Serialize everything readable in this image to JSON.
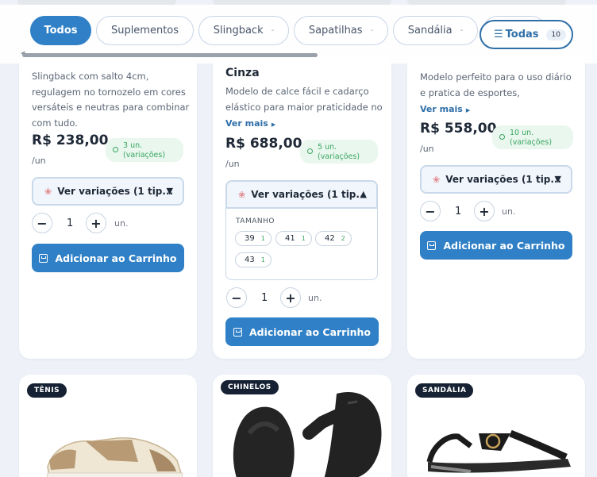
{
  "filters": {
    "chips": [
      {
        "label": "Todos",
        "active": true
      },
      {
        "label": "Suplementos",
        "active": false
      },
      {
        "label": "Slingback",
        "active": false
      },
      {
        "label": "Sapatilhas",
        "active": false
      },
      {
        "label": "Sandália",
        "active": false
      }
    ],
    "todas_label": "Todas",
    "todas_count": "10",
    "caret": "-"
  },
  "products": [
    {
      "desc_lines": [
        "Slingback com salto 4cm,",
        "regulagem no tornozelo em cores",
        "versáteis e neutras para combinar",
        "com tudo."
      ],
      "price": "R$ 238,00",
      "unit": "/un",
      "stock_line1": "3 un.",
      "stock_line2": "(variações)",
      "variations_label": "Ver variações (1 tip...",
      "arrow": "▼",
      "qty": "1",
      "qty_unit": "un.",
      "add_label": "Adicionar ao Carrinho"
    },
    {
      "title": "Cinza",
      "desc_lines": [
        "Modelo de calce fácil e cadarço",
        "elástico para maior praticidade no"
      ],
      "ver_mais": "Ver mais",
      "price": "R$ 688,00",
      "unit": "/un",
      "stock_line1": "5 un.",
      "stock_line2": "(variações)",
      "variations_label": "Ver variações (1 tip...",
      "arrow": "▲",
      "size_title": "TAMANHO",
      "sizes": [
        {
          "size": "39",
          "stock": "1"
        },
        {
          "size": "41",
          "stock": "1"
        },
        {
          "size": "42",
          "stock": "2"
        },
        {
          "size": "43",
          "stock": "1"
        }
      ],
      "qty": "1",
      "qty_unit": "un.",
      "add_label": "Adicionar ao Carrinho"
    },
    {
      "desc_lines": [
        "Modelo perfeito para o uso diário",
        "e pratica de esportes,"
      ],
      "ver_mais": "Ver mais",
      "price": "R$ 558,00",
      "unit": "/un",
      "stock_line1": "10 un.",
      "stock_line2": "(variações)",
      "variations_label": "Ver variações (1 tip...",
      "arrow": "▼",
      "qty": "1",
      "qty_unit": "un.",
      "add_label": "Adicionar ao Carrinho"
    }
  ],
  "categories": [
    {
      "badge": "TÊNIS"
    },
    {
      "badge": "CHINELOS"
    },
    {
      "badge": "SANDÁLIA"
    }
  ],
  "colors": {
    "accent": "#2f80c6",
    "stock_green": "#3aa660",
    "badge_dark": "#162233"
  }
}
